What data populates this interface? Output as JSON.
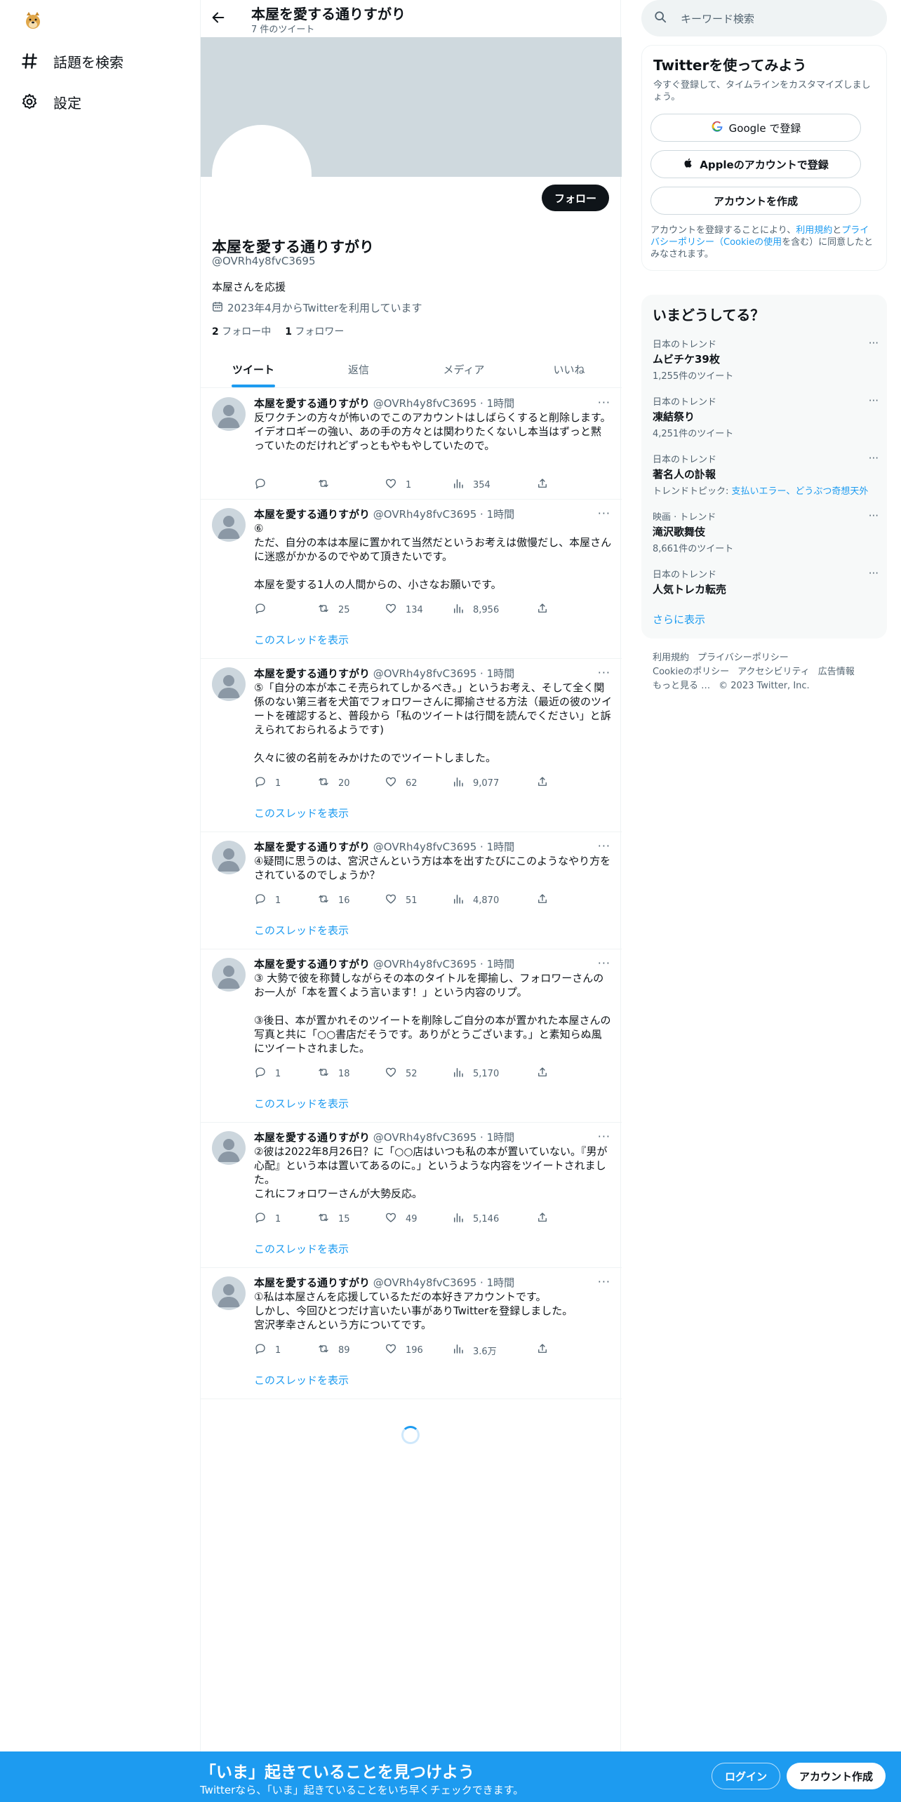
{
  "nav": {
    "logo": "doge-logo",
    "items": [
      {
        "icon": "hashtag-icon",
        "label": "話題を検索"
      },
      {
        "icon": "gear-icon",
        "label": "設定"
      }
    ]
  },
  "topbar": {
    "title": "本屋を愛する通りすがり",
    "subtitle": "7 件のツイート"
  },
  "profile": {
    "follow_label": "フォロー",
    "name": "本屋を愛する通りすがり",
    "handle": "@OVRh4y8fvC3695",
    "bio": "本屋さんを応援",
    "joined": "2023年4月からTwitterを利用しています",
    "following_count": "2",
    "following_label": "フォロー中",
    "followers_count": "1",
    "followers_label": "フォロワー"
  },
  "tabs": [
    "ツイート",
    "返信",
    "メディア",
    "いいね"
  ],
  "tweets": [
    {
      "name": "本屋を愛する通りすがり",
      "meta": " @OVRh4y8fvC3695 · 1時間",
      "text": "反ワクチンの方々が怖いのでこのアカウントはしばらくすると削除します。\nイデオロギーの強い、あの手の方々とは関わりたくないし本当はずっと黙っていたのだけれどずっともやもやしていたので。",
      "reply": "",
      "retweet": "",
      "like": "1",
      "views": "354",
      "thread": ""
    },
    {
      "name": "本屋を愛する通りすがり",
      "meta": " @OVRh4y8fvC3695 · 1時間",
      "text": "⑥\nただ、自分の本は本屋に置かれて当然だというお考えは傲慢だし、本屋さんに迷惑がかかるのでやめて頂きたいです。\n\n本屋を愛する1人の人間からの、小さなお願いです。",
      "reply": "",
      "retweet": "25",
      "like": "134",
      "views": "8,956",
      "thread": "このスレッドを表示"
    },
    {
      "name": "本屋を愛する通りすがり",
      "meta": " @OVRh4y8fvC3695 · 1時間",
      "text": "⑤「自分の本が本こそ売られてしかるべき。」というお考え、そして全く関係のない第三者を犬笛でフォロワーさんに揶揄させる方法（最近の彼のツイートを確認すると、普段から「私のツイートは行間を読んでください」と訴えられておられるようです)\n\n久々に彼の名前をみかけたのでツイートしました。",
      "reply": "1",
      "retweet": "20",
      "like": "62",
      "views": "9,077",
      "thread": "このスレッドを表示"
    },
    {
      "name": "本屋を愛する通りすがり",
      "meta": " @OVRh4y8fvC3695 · 1時間",
      "text": "④疑問に思うのは、宮沢さんという方は本を出すたびにこのようなやり方をされているのでしょうか？",
      "reply": "1",
      "retweet": "16",
      "like": "51",
      "views": "4,870",
      "thread": "このスレッドを表示"
    },
    {
      "name": "本屋を愛する通りすがり",
      "meta": " @OVRh4y8fvC3695 · 1時間",
      "text": "③ 大勢で彼を称賛しながらその本のタイトルを揶揄し、フォロワーさんのお一人が「本を置くよう言います！」という内容のリプ。\n\n③後日、本が置かれそのツイートを削除しご自分の本が置かれた本屋さんの写真と共に「○○書店だそうです。ありがとうございます。」と素知らぬ風にツイートされました。",
      "reply": "1",
      "retweet": "18",
      "like": "52",
      "views": "5,170",
      "thread": "このスレッドを表示"
    },
    {
      "name": "本屋を愛する通りすがり",
      "meta": " @OVRh4y8fvC3695 · 1時間",
      "text": "②彼は2022年8月26日？に「○○店はいつも私の本が置いていない。『男が心配』という本は置いてあるのに。」というような内容をツイートされました。\nこれにフォロワーさんが大勢反応。",
      "reply": "1",
      "retweet": "15",
      "like": "49",
      "views": "5,146",
      "thread": "このスレッドを表示"
    },
    {
      "name": "本屋を愛する通りすがり",
      "meta": " @OVRh4y8fvC3695 · 1時間",
      "text": "①私は本屋さんを応援しているただの本好きアカウントです。\nしかし、今回ひとつだけ言いたい事がありTwitterを登録しました。\n宮沢孝幸さんという方についてです。",
      "reply": "1",
      "retweet": "89",
      "like": "196",
      "views": "3.6万",
      "thread": "このスレッドを表示"
    }
  ],
  "right": {
    "search_placeholder": "キーワード検索",
    "signup": {
      "title": "Twitterを使ってみよう",
      "subtitle": "今すぐ登録して、タイムラインをカスタマイズしましょう。",
      "google": "Google で登録",
      "apple": "Appleのアカウントで登録",
      "create": "アカウントを作成",
      "terms_1": "アカウントを登録することにより、",
      "terms_link1": "利用規約",
      "terms_2": "と",
      "terms_link2": "プライバシーポリシー（Cookieの使用",
      "terms_3": "を含む）に同意したとみなされます。"
    },
    "trends_title": "いまどうしてる？",
    "trends": [
      {
        "cat": "日本のトレンド",
        "name": "ムビチケ39枚",
        "count": "1,255件のツイート",
        "link": ""
      },
      {
        "cat": "日本のトレンド",
        "name": "凍結祭り",
        "count": "4,251件のツイート",
        "link": ""
      },
      {
        "cat": "日本のトレンド",
        "name": "著名人の訃報",
        "count": "トレンドトピック: ",
        "link": "支払いエラー、どうぶつ奇想天外"
      },
      {
        "cat": "映画 · トレンド",
        "name": "滝沢歌舞伎",
        "count": "8,661件のツイート",
        "link": ""
      },
      {
        "cat": "日本のトレンド",
        "name": "人気トレカ転売",
        "count": "",
        "link": ""
      }
    ],
    "show_more": "さらに表示",
    "footer": [
      "利用規約",
      "プライバシーポリシー",
      "Cookieのポリシー",
      "アクセシビリティ",
      "広告情報",
      "もっと見る …",
      "© 2023 Twitter, Inc."
    ]
  },
  "bottombar": {
    "title": "「いま」起きていることを見つけよう",
    "subtitle": "Twitterなら、「いま」起きていることをいち早くチェックできます。",
    "login": "ログイン",
    "signup": "アカウント作成"
  },
  "colors": {
    "accent": "#1d9bf0",
    "text": "#0f1419",
    "muted": "#536471",
    "banner": "#cfd9de"
  }
}
